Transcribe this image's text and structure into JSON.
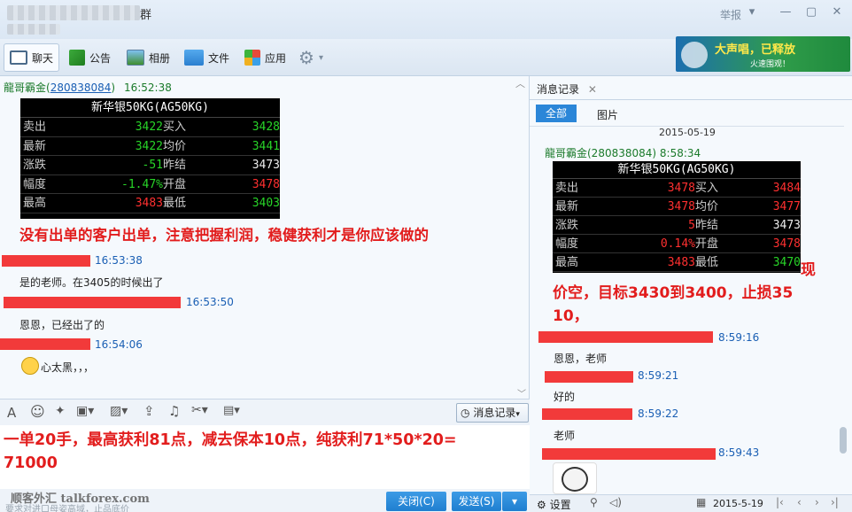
{
  "window": {
    "title_blurred": "群",
    "report": "举报"
  },
  "toolbar": {
    "chat": "聊天",
    "notice": "公告",
    "album": "相册",
    "file": "文件",
    "app": "应用"
  },
  "ad": {
    "headline": "大声唱，已释放",
    "sub": "火速围观！"
  },
  "chat": {
    "first_sender": "龍哥霸金(280838084)",
    "first_sender_name": "龍哥霸金",
    "first_sender_id": "280838084",
    "first_time": "16:52:38",
    "red_msg": "没有出单的客户出单，注意把握利润，稳健获利才是你应该做的",
    "messages": [
      {
        "time": "16:53:38",
        "text": "是的老师。在3405的时候出了"
      },
      {
        "time": "16:53:50",
        "text": "恩恩，已经出了的"
      },
      {
        "time": "16:54:06",
        "text": "心太黑，，，"
      }
    ]
  },
  "quote_left": {
    "title": "新华银50KG(AG50KG)",
    "rows": [
      {
        "l": "卖出",
        "v": "3422",
        "m": "买入",
        "r": "3428"
      },
      {
        "l": "最新",
        "v": "3422",
        "m": "均价",
        "r": "3441"
      },
      {
        "l": "涨跌",
        "v": "-51",
        "m": "昨结",
        "r": "3473"
      },
      {
        "l": "幅度",
        "v": "-1.47%",
        "m": "开盘",
        "r": "3478"
      },
      {
        "l": "最高",
        "v": "3483",
        "m": "最低",
        "r": "3403"
      }
    ]
  },
  "quote_right": {
    "title": "新华银50KG(AG50KG)",
    "rows": [
      {
        "l": "卖出",
        "v": "3478",
        "m": "买入",
        "r": "3484"
      },
      {
        "l": "最新",
        "v": "3478",
        "m": "均价",
        "r": "3477"
      },
      {
        "l": "涨跌",
        "v": "5",
        "m": "昨结",
        "r": "3473"
      },
      {
        "l": "幅度",
        "v": "0.14%",
        "m": "开盘",
        "r": "3478"
      },
      {
        "l": "最高",
        "v": "3483",
        "m": "最低",
        "r": "3470"
      }
    ]
  },
  "input": {
    "history_btn": "消息记录",
    "text_line1": "一单20手，最高获利81点，减去保本10点，纯获利71*50*20=",
    "text_line2": "71000"
  },
  "bottom": {
    "watermark": "顺客外汇 talkforex.com",
    "hint": "要求对进口母姿高域，止品底价",
    "close": "关闭(C)",
    "send": "发送(S)"
  },
  "history": {
    "tab_label": "消息记录",
    "all": "全部",
    "image": "图片",
    "date": "2015-05-19",
    "sender": "龍哥霸金(280838084) 8:58:34",
    "suffix_char": "现",
    "red_text_1": "价空，目标3430到3400，止损35",
    "red_text_2": "10，",
    "messages": [
      {
        "time": "8:59:16",
        "text": "恩恩，老师"
      },
      {
        "time": "8:59:21",
        "text": "好的"
      },
      {
        "time": "8:59:22",
        "text": "老师"
      },
      {
        "time": "8:59:43",
        "text": ""
      }
    ],
    "footer_settings": "设置",
    "footer_date": "2015-5-19"
  }
}
